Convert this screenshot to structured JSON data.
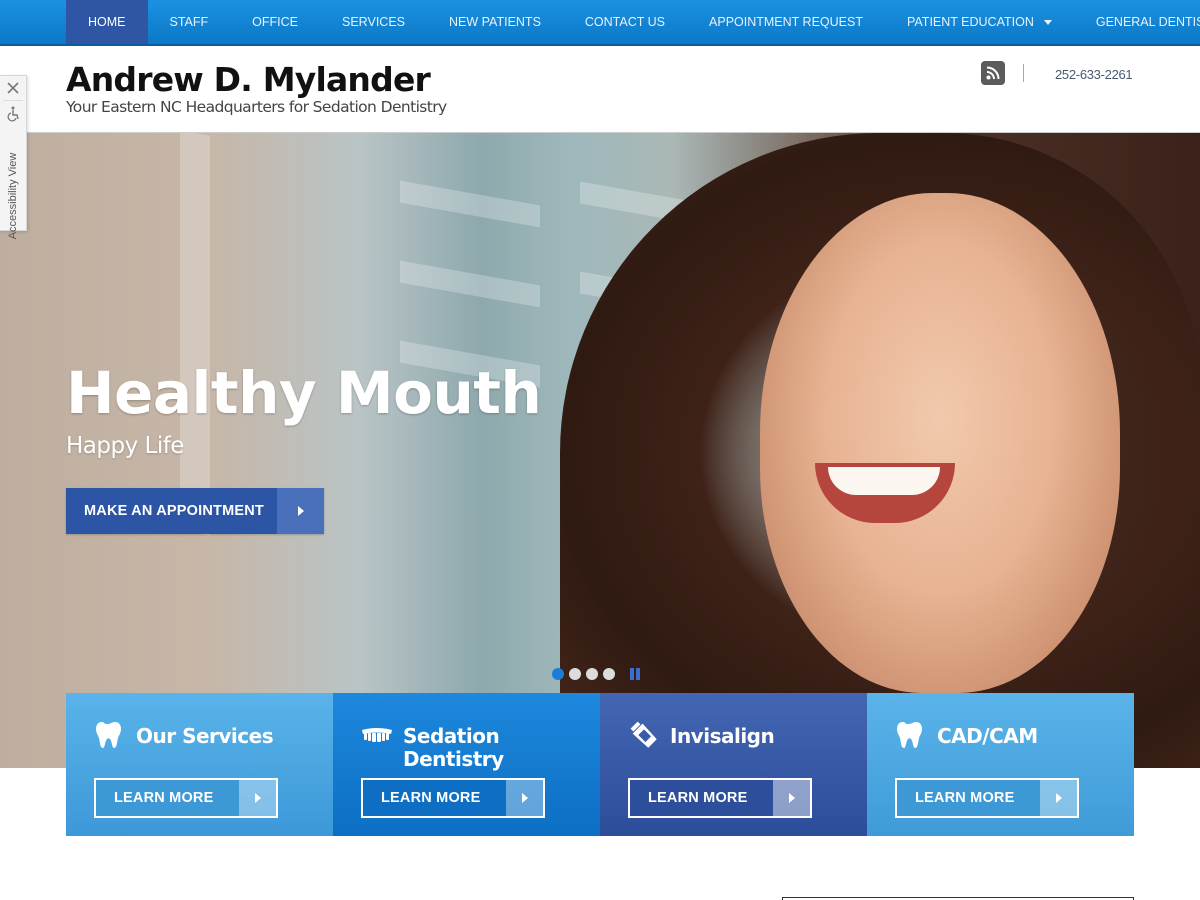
{
  "nav": {
    "items": [
      {
        "label": "HOME",
        "active": true
      },
      {
        "label": "STAFF"
      },
      {
        "label": "OFFICE"
      },
      {
        "label": "SERVICES"
      },
      {
        "label": "NEW PATIENTS"
      },
      {
        "label": "CONTACT US"
      },
      {
        "label": "APPOINTMENT REQUEST"
      },
      {
        "label": "PATIENT EDUCATION",
        "dropdown": true
      },
      {
        "label": "GENERAL DENTIST | NEW BERN"
      }
    ],
    "colors": {
      "bar": "#1186d6",
      "active": "#2f56a4"
    }
  },
  "header": {
    "title": "Andrew D. Mylander",
    "tagline": "Your Eastern NC Headquarters for Sedation Dentistry",
    "rss_icon": "rss-icon",
    "phone": "252-633-2261"
  },
  "accessibility": {
    "label": "Accessibility View",
    "close_icon": "close-icon",
    "icon": "wheelchair-icon"
  },
  "hero": {
    "heading": "Healthy Mouth",
    "subheading": "Happy Life",
    "cta_label": "MAKE AN APPOINTMENT",
    "slides_total": 4,
    "active_slide": 1,
    "pause_icon": "pause-icon"
  },
  "cards": [
    {
      "title": "Our Services",
      "icon": "tooth-icon",
      "button": "LEARN MORE",
      "color": "#4aa8e3"
    },
    {
      "title": "Sedation Dentistry",
      "icon": "dentures-icon",
      "button": "LEARN MORE",
      "color": "#1580d2"
    },
    {
      "title": "Invisalign",
      "icon": "toothpaste-icon",
      "button": "LEARN MORE",
      "color": "#385aa6"
    },
    {
      "title": "CAD/CAM",
      "icon": "tooth-icon",
      "button": "LEARN MORE",
      "color": "#4aa8e3"
    }
  ]
}
